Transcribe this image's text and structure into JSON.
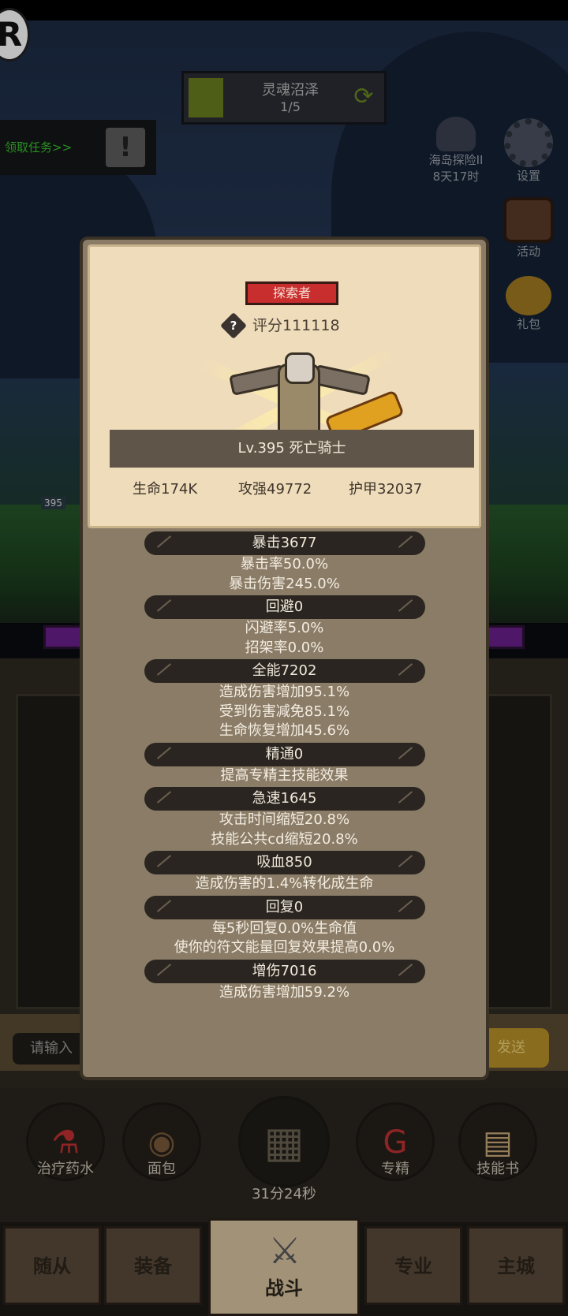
{
  "area": {
    "name": "灵魂沼泽",
    "progress": "1/5"
  },
  "quest": {
    "label": "领取任务>>"
  },
  "side_buttons": {
    "adventure": {
      "label": "海岛探险II",
      "timer": "8天17时"
    },
    "settings": "设置",
    "activity": "活动",
    "gift": "礼包"
  },
  "hero": {
    "class_badge": "探索者",
    "score": "评分111118",
    "level_name": "Lv.395 死亡骑士",
    "hp": "生命174K",
    "attack": "攻强49772",
    "armor": "护甲32037",
    "mini_level": "395"
  },
  "attributes": [
    {
      "header": "暴击3677",
      "lines": [
        "暴击率50.0%",
        "暴击伤害245.0%"
      ]
    },
    {
      "header": "回避0",
      "lines": [
        "闪避率5.0%",
        "招架率0.0%"
      ]
    },
    {
      "header": "全能7202",
      "lines": [
        "造成伤害增加95.1%",
        "受到伤害减免85.1%",
        "生命恢复增加45.6%"
      ]
    },
    {
      "header": "精通0",
      "lines": [
        "提高专精主技能效果"
      ]
    },
    {
      "header": "急速1645",
      "lines": [
        "攻击时间缩短20.8%",
        "技能公共cd缩短20.8%"
      ]
    },
    {
      "header": "吸血850",
      "lines": [
        "造成伤害的1.4%转化成生命"
      ]
    },
    {
      "header": "回复0",
      "lines": [
        "每5秒回复0.0%生命值",
        "使你的符文能量回复效果提高0.0%"
      ]
    },
    {
      "header": "增伤7016",
      "lines": [
        "造成伤害增加59.2%"
      ]
    }
  ],
  "chat": {
    "placeholder": "请输入",
    "send": "发送"
  },
  "dock": {
    "potion": "治疗药水",
    "bread": "面包",
    "chest_timer": "31分24秒",
    "specialization": "专精",
    "skill_book": "技能书"
  },
  "nav": {
    "followers": "随从",
    "equipment": "装备",
    "battle": "战斗",
    "profession": "专业",
    "main_city": "主城"
  },
  "logo_letter": "R",
  "colors": {
    "badge_red": "#c92e2e",
    "quest_green": "#35c22a",
    "panel": "#8a7c66",
    "card": "#efdcba"
  }
}
